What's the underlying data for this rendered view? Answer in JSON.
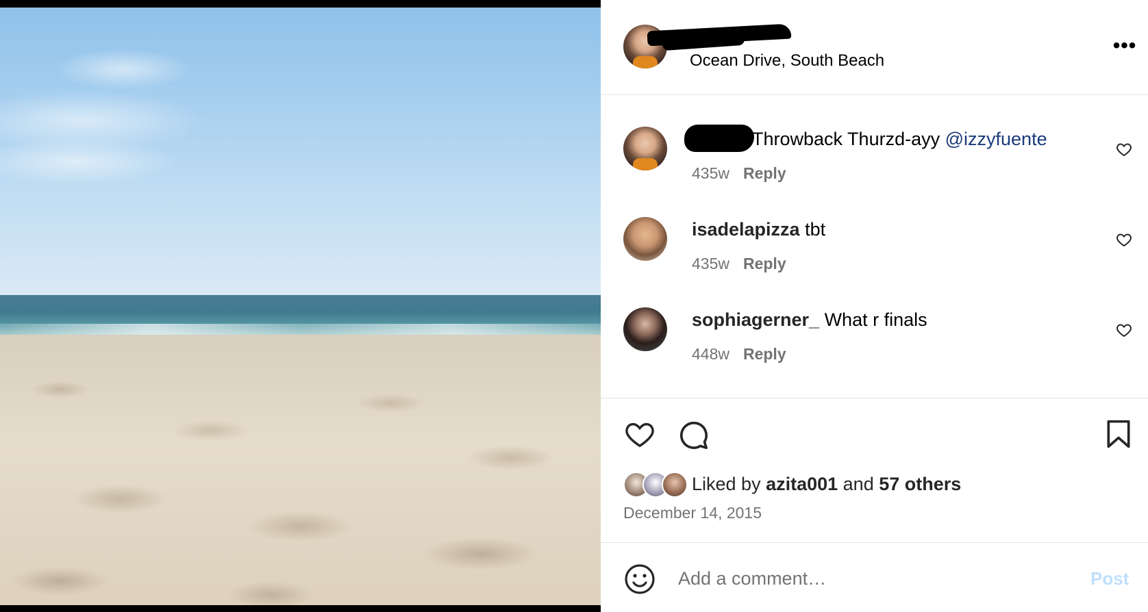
{
  "post": {
    "location": "Ocean Drive, South Beach",
    "more_label": "•••"
  },
  "comments": [
    {
      "username": "",
      "text": "Throwback Thurzd-ayy ",
      "mention": "@izzyfuente",
      "time": "435w",
      "reply": "Reply"
    },
    {
      "username": "isadelapizza",
      "text": " tbt",
      "time": "435w",
      "reply": "Reply"
    },
    {
      "username": "sophiagerner_",
      "text": " What r finals",
      "time": "448w",
      "reply": "Reply"
    }
  ],
  "likes": {
    "prefix": "Liked by ",
    "user": "azita001",
    "conj": " and ",
    "others": "57 others"
  },
  "date": "December 14, 2015",
  "composer": {
    "placeholder": "Add a comment…",
    "post_label": "Post"
  },
  "colors": {
    "mention": "#1a3a7a",
    "post_disabled": "#c0dffd",
    "meta": "#737373"
  }
}
